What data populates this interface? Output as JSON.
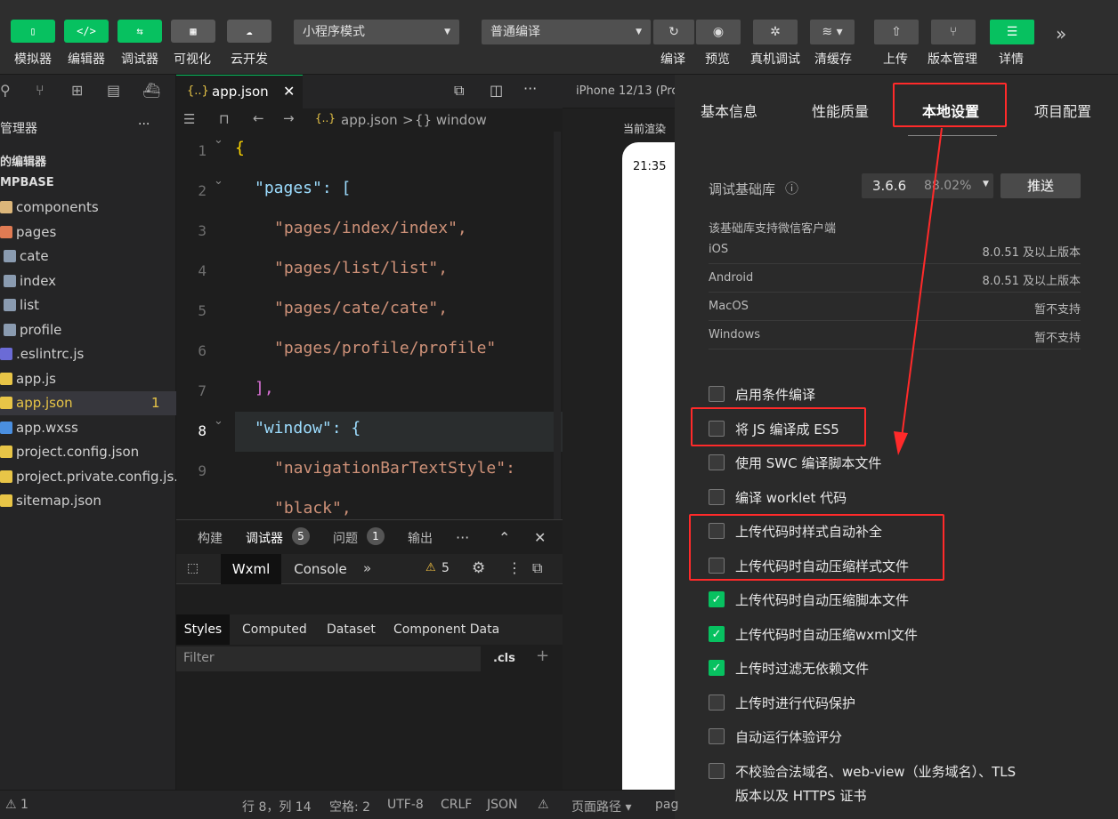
{
  "toolbar": {
    "left_buttons": [
      {
        "glyph": "▯",
        "label": "模拟器"
      },
      {
        "glyph": "</>",
        "label": "编辑器"
      },
      {
        "glyph": "⇆",
        "label": "调试器"
      },
      {
        "glyph": "▦",
        "label": "可视化"
      },
      {
        "glyph": "☁",
        "label": "云开发"
      }
    ],
    "mode_select": "小程序模式",
    "compile_select": "普通编译",
    "right_buttons": [
      {
        "glyph": "↻",
        "label": "编译"
      },
      {
        "glyph": "◉",
        "label": "预览"
      },
      {
        "glyph": "✲",
        "label": "真机调试"
      },
      {
        "glyph": "≋ ▾",
        "label": "清缓存"
      },
      {
        "glyph": "⇧",
        "label": "上传"
      },
      {
        "glyph": "⑂",
        "label": "版本管理"
      },
      {
        "glyph": "☰",
        "label": "详情"
      }
    ],
    "more": "»"
  },
  "explorer": {
    "title": "管理器",
    "more": "···",
    "section": "的编辑器",
    "root": "MPBASE",
    "items": [
      {
        "name": "components",
        "color": "#dcb67a"
      },
      {
        "name": "pages",
        "color": "#e07b53"
      },
      {
        "name": "cate",
        "color": "#8a9bb0"
      },
      {
        "name": "index",
        "color": "#8a9bb0"
      },
      {
        "name": "list",
        "color": "#8a9bb0"
      },
      {
        "name": "profile",
        "color": "#8a9bb0"
      },
      {
        "name": ".eslintrc.js",
        "color": "#6b6bd6"
      },
      {
        "name": "app.js",
        "color": "#e8c547"
      },
      {
        "name": "app.json",
        "color": "#e8c547",
        "badge": "1"
      },
      {
        "name": "app.wxss",
        "color": "#4a8fe0"
      },
      {
        "name": "project.config.json",
        "color": "#e8c547"
      },
      {
        "name": "project.private.config.js...",
        "color": "#e8c547"
      },
      {
        "name": "sitemap.json",
        "color": "#e8c547"
      }
    ]
  },
  "editor": {
    "tab": "app.json",
    "tab_icon": "{..}",
    "breadcrumb_file": "app.json",
    "breadcrumb_sep": ">",
    "breadcrumb_node": "{} window",
    "line_numbers": [
      "1",
      "2",
      "3",
      "4",
      "5",
      "6",
      "7",
      "8",
      "9"
    ],
    "lines": [
      {
        "t": "{",
        "c": "y"
      },
      {
        "t": "\"pages\": [",
        "c": "k"
      },
      {
        "t": "\"pages/index/index\",",
        "c": "s"
      },
      {
        "t": "\"pages/list/list\",",
        "c": "s"
      },
      {
        "t": "\"pages/cate/cate\",",
        "c": "s"
      },
      {
        "t": "\"pages/profile/profile\"",
        "c": "s"
      },
      {
        "t": "],",
        "c": "b"
      },
      {
        "t": "\"window\": {",
        "c": "k"
      },
      {
        "t": "\"navigationBarTextStyle\":",
        "c": "s"
      },
      {
        "t": "\"black\",",
        "c": "s"
      }
    ]
  },
  "debug": {
    "tabs": [
      "构建",
      "调试器",
      "问题",
      "输出"
    ],
    "debugger_badge": "5",
    "issues_badge": "1",
    "more": "···",
    "devtools_tabs": [
      "Wxml",
      "Console"
    ],
    "warn_count": "5",
    "style_tabs": [
      "Styles",
      "Computed",
      "Dataset",
      "Component Data"
    ],
    "filter_placeholder": "Filter",
    "cls": ".cls",
    "plus": "+"
  },
  "simulator": {
    "device": "iPhone 12/13 (Pro",
    "render_label": "当前渲染",
    "time": "21:35"
  },
  "details": {
    "tabs": [
      "基本信息",
      "性能质量",
      "本地设置",
      "项目配置"
    ],
    "active_tab": "本地设置",
    "base_lib_label": "调试基础库",
    "base_lib_version": "3.6.6",
    "base_lib_share": "88.02%",
    "push_button": "推送",
    "support_title": "该基础库支持微信客户端",
    "platforms": [
      {
        "name": "iOS",
        "value": "8.0.51 及以上版本"
      },
      {
        "name": "Android",
        "value": "8.0.51 及以上版本"
      },
      {
        "name": "MacOS",
        "value": "暂不支持"
      },
      {
        "name": "Windows",
        "value": "暂不支持"
      }
    ],
    "options": [
      {
        "label": "启用条件编译",
        "checked": false
      },
      {
        "label": "将 JS 编译成 ES5",
        "checked": false
      },
      {
        "label": "使用 SWC 编译脚本文件",
        "checked": false
      },
      {
        "label": "编译 worklet 代码",
        "checked": false
      },
      {
        "label": "上传代码时样式自动补全",
        "checked": false
      },
      {
        "label": "上传代码时自动压缩样式文件",
        "checked": false
      },
      {
        "label": "上传代码时自动压缩脚本文件",
        "checked": true
      },
      {
        "label": "上传代码时自动压缩wxml文件",
        "checked": true
      },
      {
        "label": "上传时过滤无依赖文件",
        "checked": true
      },
      {
        "label": "上传时进行代码保护",
        "checked": false
      },
      {
        "label": "自动运行体验评分",
        "checked": false
      },
      {
        "label": "不校验合法域名、web-view（业务域名）、TLS",
        "checked": false
      }
    ],
    "option_last_line2": "版本以及 HTTPS 证书"
  },
  "status": {
    "errors": "⚠ 1",
    "position": "行 8，列 14",
    "spaces": "空格: 2",
    "encoding": "UTF-8",
    "eol": "CRLF",
    "lang": "JSON",
    "warn_icon": "⚠",
    "page_path": "页面路径 ▾",
    "page_path_value": "pag"
  },
  "colors": {
    "accent": "#07c160",
    "highlight": "#ff2a2a"
  }
}
